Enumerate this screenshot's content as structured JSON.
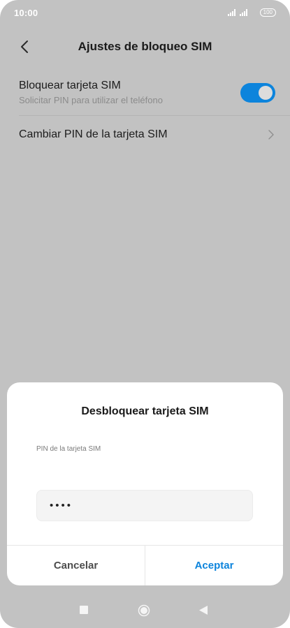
{
  "status_bar": {
    "time": "10:00",
    "battery": "100"
  },
  "header": {
    "title": "Ajustes de bloqueo SIM"
  },
  "settings": {
    "lock_sim": {
      "title": "Bloquear tarjeta SIM",
      "subtitle": "Solicitar PIN para utilizar el teléfono",
      "enabled": true
    },
    "change_pin": {
      "title": "Cambiar PIN de la tarjeta SIM"
    }
  },
  "dialog": {
    "title": "Desbloquear tarjeta SIM",
    "field_label": "PIN de la tarjeta SIM",
    "pin_value": "••••",
    "cancel_label": "Cancelar",
    "accept_label": "Aceptar"
  },
  "colors": {
    "accent": "#0d84dc",
    "overlay": "#c2c2c2"
  },
  "icons": {
    "back": "chevron-left-icon",
    "change_pin_arrow": "chevron-right-icon",
    "nav_recents": "square-icon",
    "nav_home": "circle-icon",
    "nav_back": "triangle-back-icon"
  }
}
